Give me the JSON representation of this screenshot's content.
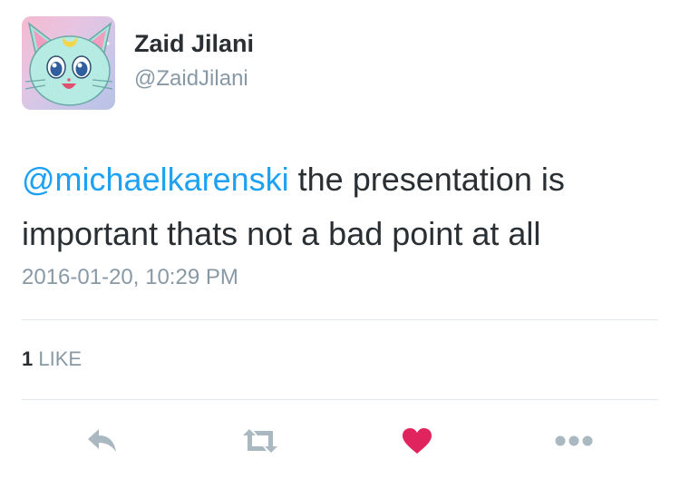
{
  "author": {
    "name": "Zaid Jilani",
    "handle": "@ZaidJilani"
  },
  "tweet": {
    "mention": "@michaelkarenski",
    "text_line1": " the presentation is",
    "text_line2": "important thats not a bad point at all",
    "timestamp": "2016-01-20, 10:29 PM"
  },
  "stats": {
    "like_count": "1",
    "like_label": "LIKE"
  },
  "actions": {
    "reply_icon": "reply-icon",
    "retweet_icon": "retweet-icon",
    "like_icon": "heart-icon",
    "more_icon": "more-icon"
  },
  "colors": {
    "mention": "#1da1f2",
    "muted": "#8899a6",
    "like_active": "#e0245e",
    "icon": "#aab8c2"
  }
}
